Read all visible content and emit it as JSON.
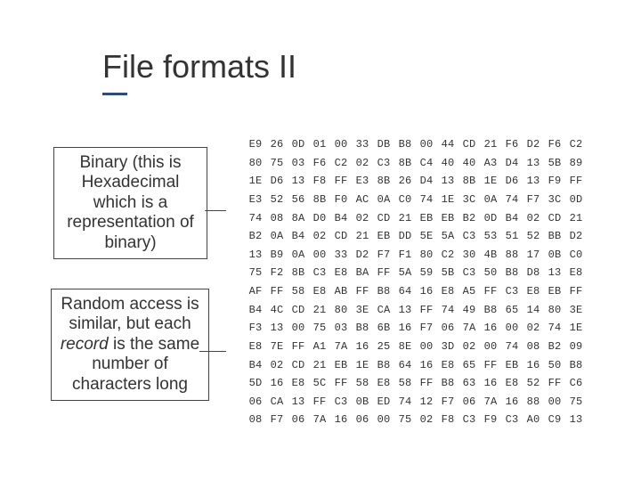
{
  "title": "File formats II",
  "callouts": {
    "binary": "Binary (this is Hexadecimal which is a representation of binary)",
    "random": [
      "Random access is similar, but each ",
      "record",
      " is the same number of characters long"
    ]
  },
  "hex_rows": [
    [
      "E9",
      "26",
      "0D",
      "01",
      "00",
      "33",
      "DB",
      "B8",
      "00",
      "44",
      "CD",
      "21",
      "F6",
      "D2",
      "F6",
      "C2"
    ],
    [
      "80",
      "75",
      "03",
      "F6",
      "C2",
      "02",
      "C3",
      "8B",
      "C4",
      "40",
      "40",
      "A3",
      "D4",
      "13",
      "5B",
      "89"
    ],
    [
      "1E",
      "D6",
      "13",
      "F8",
      "FF",
      "E3",
      "8B",
      "26",
      "D4",
      "13",
      "8B",
      "1E",
      "D6",
      "13",
      "F9",
      "FF"
    ],
    [
      "E3",
      "52",
      "56",
      "8B",
      "F0",
      "AC",
      "0A",
      "C0",
      "74",
      "1E",
      "3C",
      "0A",
      "74",
      "F7",
      "3C",
      "0D"
    ],
    [
      "74",
      "08",
      "8A",
      "D0",
      "B4",
      "02",
      "CD",
      "21",
      "EB",
      "EB",
      "B2",
      "0D",
      "B4",
      "02",
      "CD",
      "21"
    ],
    [
      "B2",
      "0A",
      "B4",
      "02",
      "CD",
      "21",
      "EB",
      "DD",
      "5E",
      "5A",
      "C3",
      "53",
      "51",
      "52",
      "BB",
      "D2"
    ],
    [
      "13",
      "B9",
      "0A",
      "00",
      "33",
      "D2",
      "F7",
      "F1",
      "80",
      "C2",
      "30",
      "4B",
      "88",
      "17",
      "0B",
      "C0"
    ],
    [
      "75",
      "F2",
      "8B",
      "C3",
      "E8",
      "BA",
      "FF",
      "5A",
      "59",
      "5B",
      "C3",
      "50",
      "B8",
      "D8",
      "13",
      "E8"
    ],
    [
      "AF",
      "FF",
      "58",
      "E8",
      "AB",
      "FF",
      "B8",
      "64",
      "16",
      "E8",
      "A5",
      "FF",
      "C3",
      "E8",
      "EB",
      "FF"
    ],
    [
      "B4",
      "4C",
      "CD",
      "21",
      "80",
      "3E",
      "CA",
      "13",
      "FF",
      "74",
      "49",
      "B8",
      "65",
      "14",
      "80",
      "3E"
    ],
    [
      "F3",
      "13",
      "00",
      "75",
      "03",
      "B8",
      "6B",
      "16",
      "F7",
      "06",
      "7A",
      "16",
      "00",
      "02",
      "74",
      "1E"
    ],
    [
      "E8",
      "7E",
      "FF",
      "A1",
      "7A",
      "16",
      "25",
      "8E",
      "00",
      "3D",
      "02",
      "00",
      "74",
      "08",
      "B2",
      "09"
    ],
    [
      "B4",
      "02",
      "CD",
      "21",
      "EB",
      "1E",
      "B8",
      "64",
      "16",
      "E8",
      "65",
      "FF",
      "EB",
      "16",
      "50",
      "B8"
    ],
    [
      "5D",
      "16",
      "E8",
      "5C",
      "FF",
      "58",
      "E8",
      "58",
      "FF",
      "B8",
      "63",
      "16",
      "E8",
      "52",
      "FF",
      "C6"
    ],
    [
      "06",
      "CA",
      "13",
      "FF",
      "C3",
      "0B",
      "ED",
      "74",
      "12",
      "F7",
      "06",
      "7A",
      "16",
      "88",
      "00",
      "75"
    ],
    [
      "08",
      "F7",
      "06",
      "7A",
      "16",
      "06",
      "00",
      "75",
      "02",
      "F8",
      "C3",
      "F9",
      "C3",
      "A0",
      "C9",
      "13"
    ]
  ]
}
